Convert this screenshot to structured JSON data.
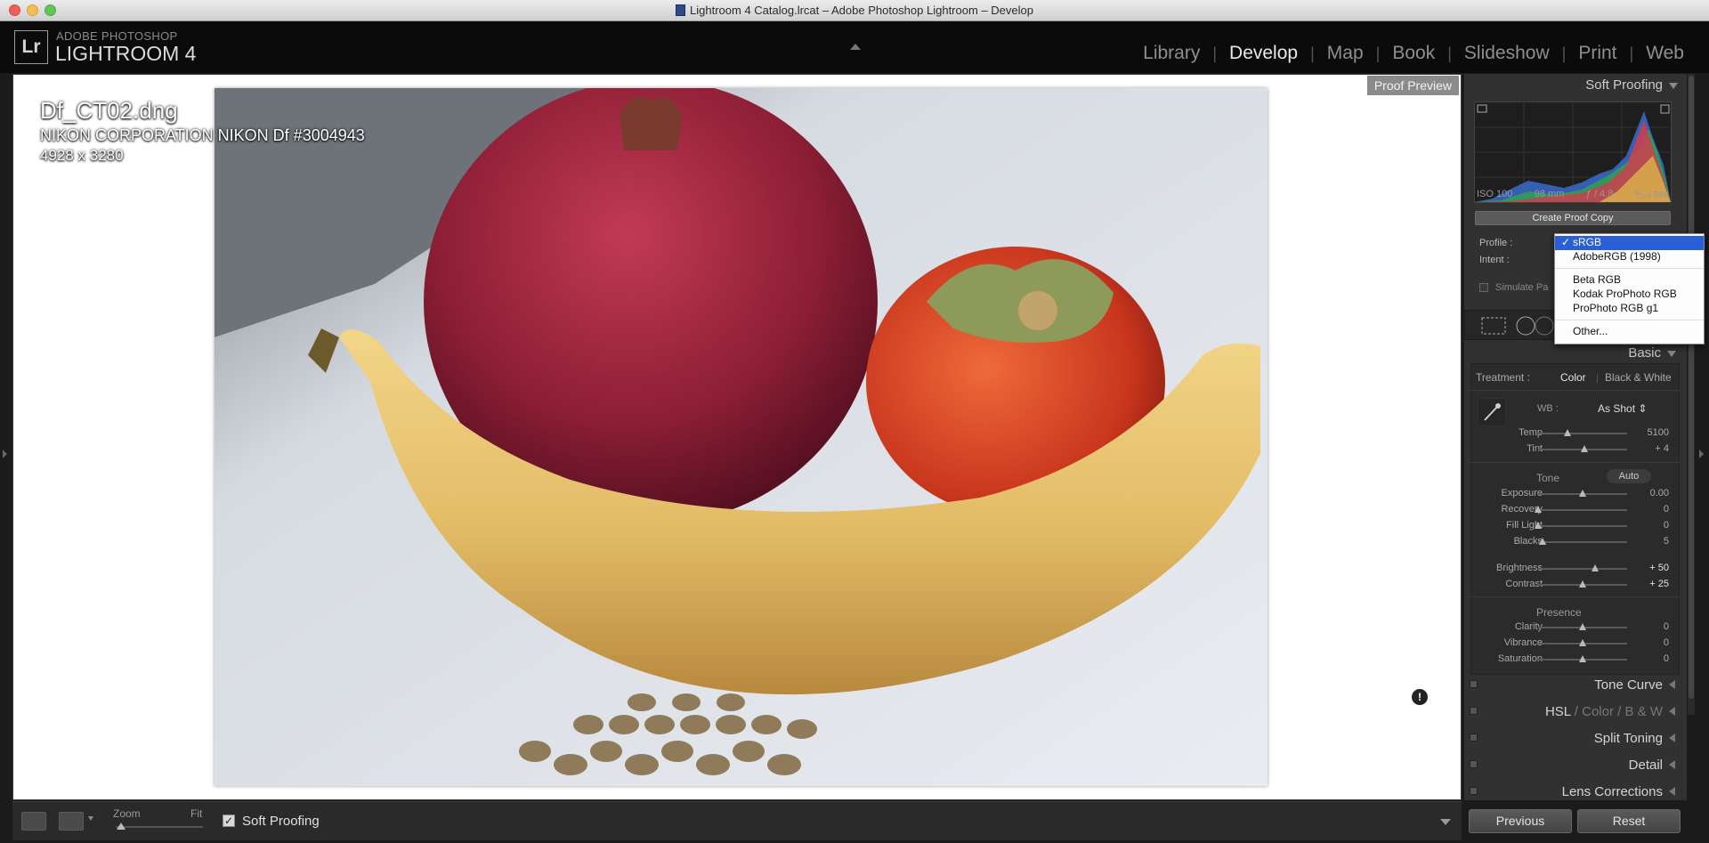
{
  "window": {
    "title": "Lightroom 4 Catalog.lrcat – Adobe Photoshop Lightroom – Develop"
  },
  "brand": {
    "logo": "Lr",
    "top": "ADOBE PHOTOSHOP",
    "main": "LIGHTROOM 4"
  },
  "modules": [
    {
      "label": "Library"
    },
    {
      "label": "Develop"
    },
    {
      "label": "Map"
    },
    {
      "label": "Book"
    },
    {
      "label": "Slideshow"
    },
    {
      "label": "Print"
    },
    {
      "label": "Web"
    }
  ],
  "image_info": {
    "filename": "Df_CT02.dng",
    "camera": "NIKON CORPORATION NIKON Df #3004943",
    "dimensions": "4928 x 3280"
  },
  "proof_preview": "Proof Preview",
  "toolbar": {
    "zoom_label": "Zoom",
    "fit_label": "Fit",
    "soft_proofing_label": "Soft Proofing",
    "soft_proofing_checked": true
  },
  "soft_proofing": {
    "header": "Soft Proofing",
    "exif": {
      "iso": "ISO 100",
      "focal": "98 mm",
      "aperture": "ƒ / 4.8",
      "shutter": "¹⁄₁₂₅ sec"
    },
    "create_proof_copy": "Create Proof Copy",
    "profile_label": "Profile :",
    "intent_label": "Intent :",
    "simulate_paper": "Simulate Pa"
  },
  "profile_dropdown": {
    "selected": "sRGB",
    "options_group1": [
      "AdobeRGB (1998)"
    ],
    "options_group2": [
      "Beta RGB",
      "Kodak ProPhoto RGB",
      "ProPhoto RGB g1"
    ],
    "other": "Other..."
  },
  "basic": {
    "header": "Basic",
    "treatment_label": "Treatment :",
    "treatment_color": "Color",
    "treatment_bw": "Black & White",
    "wb_label": "WB :",
    "wb_value": "As Shot",
    "wb_sliders": [
      {
        "label": "Temp",
        "value": "5100",
        "pos": 0.33
      },
      {
        "label": "Tint",
        "value": "+ 4",
        "pos": 0.52
      }
    ],
    "tone_label": "Tone",
    "auto_label": "Auto",
    "tone_sliders": [
      {
        "label": "Exposure",
        "value": "0.00",
        "pos": 0.5
      },
      {
        "label": "Recovery",
        "value": "0",
        "pos": 0.0
      },
      {
        "label": "Fill Light",
        "value": "0",
        "pos": 0.0
      },
      {
        "label": "Blacks",
        "value": "5",
        "pos": 0.05
      }
    ],
    "bright_sliders": [
      {
        "label": "Brightness",
        "value": "+ 50",
        "pos": 0.64
      },
      {
        "label": "Contrast",
        "value": "+ 25",
        "pos": 0.5
      }
    ],
    "presence_label": "Presence",
    "presence_sliders": [
      {
        "label": "Clarity",
        "value": "0",
        "pos": 0.5
      },
      {
        "label": "Vibrance",
        "value": "0",
        "pos": 0.5
      },
      {
        "label": "Saturation",
        "value": "0",
        "pos": 0.5
      }
    ]
  },
  "panels": {
    "tone_curve": "Tone Curve",
    "hsl": "HSL",
    "hsl_color": "Color",
    "hsl_bw": "B & W",
    "split_toning": "Split Toning",
    "detail": "Detail",
    "lens_corrections": "Lens Corrections"
  },
  "bottom": {
    "previous": "Previous",
    "reset": "Reset"
  },
  "colors": {
    "accent": "#2a5fd8",
    "panel_bg": "#313131",
    "header_bg": "#0b0b0b"
  }
}
